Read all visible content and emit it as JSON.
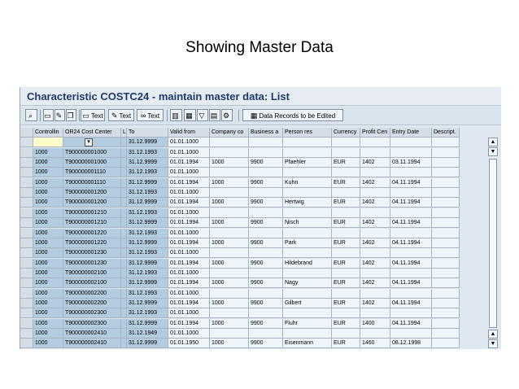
{
  "slide": {
    "title": "Showing Master Data"
  },
  "window": {
    "title": "Characteristic COSTC24 - maintain master data: List"
  },
  "toolbar": {
    "buttons": [
      {
        "label": "",
        "icon": "magnifier-icon"
      },
      {
        "label": "",
        "icon": "page-icon"
      },
      {
        "label": "",
        "icon": "pencil-icon"
      },
      {
        "label": "",
        "icon": "copy-icon"
      },
      {
        "label": "Text",
        "icon": "page-text-icon"
      },
      {
        "label": "Text",
        "icon": "pencil-text-icon"
      },
      {
        "label": "Text",
        "icon": "glasses-text-icon"
      },
      {
        "label": "",
        "icon": "trash-icon"
      },
      {
        "label": "",
        "icon": "select-all-icon"
      },
      {
        "label": "",
        "icon": "filter-icon"
      },
      {
        "label": "",
        "icon": "deselect-icon"
      },
      {
        "label": "",
        "icon": "settings-icon"
      },
      {
        "label": "Data Records to be Edited",
        "icon": "records-icon"
      }
    ]
  },
  "table": {
    "columns": [
      "Controllin",
      "OR24 Cost Center",
      "L",
      "To",
      "Valid from",
      "Company co",
      "Business a",
      "Person res",
      "Currency",
      "Profit Cen",
      "Entry Date",
      "Descript."
    ],
    "rows": [
      [
        "",
        "",
        "",
        "31.12.9999",
        "01.01.1000",
        "",
        "",
        "",
        "",
        "",
        "",
        ""
      ],
      [
        "1000",
        "T900000001000",
        "",
        "31.12.1993",
        "01.01.1000",
        "",
        "",
        "",
        "",
        "",
        "",
        ""
      ],
      [
        "1000",
        "T900000001000",
        "",
        "31.12.9999",
        "01.01.1994",
        "1000",
        "9900",
        "Pfaehler",
        "EUR",
        "1402",
        "03.11.1994",
        ""
      ],
      [
        "1000",
        "T900000001110",
        "",
        "31.12.1993",
        "01.01.1000",
        "",
        "",
        "",
        "",
        "",
        "",
        ""
      ],
      [
        "1000",
        "T900000001110",
        "",
        "31.12.9999",
        "01.01.1994",
        "1000",
        "9900",
        "Kuhn",
        "EUR",
        "1402",
        "04.11.1994",
        ""
      ],
      [
        "1000",
        "T900000001200",
        "",
        "31.12.1993",
        "01.01.1000",
        "",
        "",
        "",
        "",
        "",
        "",
        ""
      ],
      [
        "1000",
        "T900000001200",
        "",
        "31.12.9999",
        "01.01.1994",
        "1000",
        "9900",
        "Hertwig",
        "EUR",
        "1402",
        "04.11.1994",
        ""
      ],
      [
        "1000",
        "T900000001210",
        "",
        "31.12.1993",
        "01.01.1000",
        "",
        "",
        "",
        "",
        "",
        "",
        ""
      ],
      [
        "1000",
        "T900000001210",
        "",
        "31.12.9999",
        "01.01.1994",
        "1000",
        "9900",
        "Nisch",
        "EUR",
        "1402",
        "04.11.1994",
        ""
      ],
      [
        "1000",
        "T900000001220",
        "",
        "31.12.1993",
        "01.01.1000",
        "",
        "",
        "",
        "",
        "",
        "",
        ""
      ],
      [
        "1000",
        "T900000001220",
        "",
        "31.12.9999",
        "01.01.1994",
        "1000",
        "9900",
        "Park",
        "EUR",
        "1402",
        "04.11.1994",
        ""
      ],
      [
        "1000",
        "T900000001230",
        "",
        "31.12.1993",
        "01.01.1000",
        "",
        "",
        "",
        "",
        "",
        "",
        ""
      ],
      [
        "1000",
        "T900000001230",
        "",
        "31.12.9999",
        "01.01.1994",
        "1000",
        "9900",
        "Hildebrand",
        "EUR",
        "1402",
        "04.11.1994",
        ""
      ],
      [
        "1000",
        "T900000002100",
        "",
        "31.12.1993",
        "01.01.1000",
        "",
        "",
        "",
        "",
        "",
        "",
        ""
      ],
      [
        "1000",
        "T900000002100",
        "",
        "31.12.9999",
        "01.01.1994",
        "1000",
        "9900",
        "Nagy",
        "EUR",
        "1402",
        "04.11.1994",
        ""
      ],
      [
        "1000",
        "T900000002200",
        "",
        "31.12.1993",
        "01.01.1000",
        "",
        "",
        "",
        "",
        "",
        "",
        ""
      ],
      [
        "1000",
        "T900000002200",
        "",
        "31.12.9999",
        "01.01.1994",
        "1000",
        "9900",
        "Gilbert",
        "EUR",
        "1402",
        "04.11.1994",
        ""
      ],
      [
        "1000",
        "T900000002300",
        "",
        "31.12.1993",
        "01.01.1000",
        "",
        "",
        "",
        "",
        "",
        "",
        ""
      ],
      [
        "1000",
        "T900000002300",
        "",
        "31.12.9999",
        "01.01.1994",
        "1000",
        "9900",
        "Fluhr",
        "EUR",
        "1400",
        "04.11.1994",
        ""
      ],
      [
        "1000",
        "T900000002410",
        "",
        "31.12.1949",
        "01.01.1000",
        "",
        "",
        "",
        "",
        "",
        "",
        ""
      ],
      [
        "1000",
        "T900000002410",
        "",
        "31.12.9999",
        "01.01.1950",
        "1000",
        "9900",
        "Eisenmann",
        "EUR",
        "1460",
        "08.12.1998",
        ""
      ]
    ]
  },
  "colors": {
    "title": "#1f3a6d",
    "key_cell": "#b3ccdf",
    "data_cell": "#eef6fb",
    "header": "#d5dde7"
  }
}
